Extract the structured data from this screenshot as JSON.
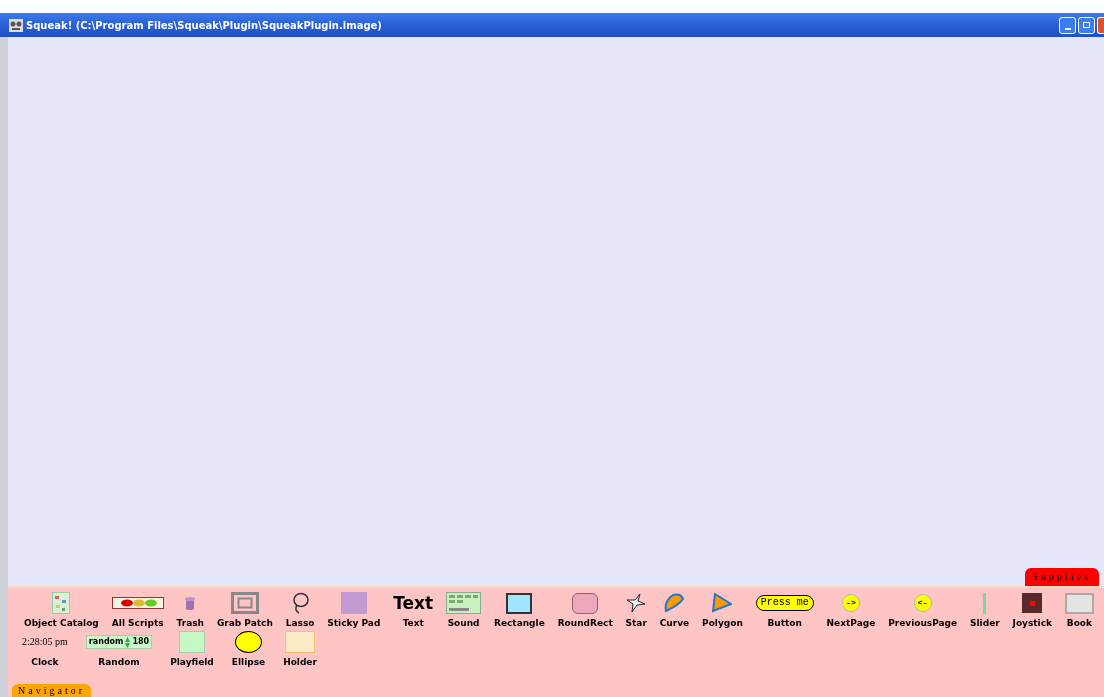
{
  "window": {
    "title": "Squeak! (C:\\Program Files\\Squeak\\Plugin\\SqueakPlugin.image)"
  },
  "supplies_flap": {
    "tab": "Supplies",
    "rows": [
      [
        {
          "kind": "catalog",
          "label": "Object Catalog"
        },
        {
          "kind": "scripts",
          "label": "All Scripts"
        },
        {
          "kind": "trash",
          "label": "Trash"
        },
        {
          "kind": "grabpatch",
          "label": "Grab Patch"
        },
        {
          "kind": "lasso",
          "label": "Lasso"
        },
        {
          "kind": "stickypad",
          "label": "Sticky Pad"
        },
        {
          "kind": "text",
          "label": "Text",
          "preview": "Text"
        },
        {
          "kind": "sound",
          "label": "Sound"
        },
        {
          "kind": "rectangle",
          "label": "Rectangle"
        },
        {
          "kind": "roundrect",
          "label": "RoundRect"
        },
        {
          "kind": "star",
          "label": "Star"
        },
        {
          "kind": "curve",
          "label": "Curve"
        },
        {
          "kind": "polygon",
          "label": "Polygon"
        },
        {
          "kind": "button",
          "label": "Button",
          "preview": "Press me"
        },
        {
          "kind": "pagebutton",
          "label": "NextPage",
          "preview": "->"
        },
        {
          "kind": "pagebutton",
          "label": "PreviousPage",
          "preview": "<-"
        },
        {
          "kind": "slider",
          "label": "Slider"
        },
        {
          "kind": "joystick",
          "label": "Joystick"
        },
        {
          "kind": "book",
          "label": "Book"
        }
      ],
      [
        {
          "kind": "clock",
          "label": "Clock",
          "preview": "2:28:05 pm"
        },
        {
          "kind": "random",
          "label": "Random",
          "preview": "random",
          "value": "180"
        },
        {
          "kind": "playfield",
          "label": "Playfield"
        },
        {
          "kind": "ellipse",
          "label": "Ellipse"
        },
        {
          "kind": "holder",
          "label": "Holder"
        }
      ]
    ]
  },
  "navigator_flap": {
    "tab": "Navigator"
  }
}
